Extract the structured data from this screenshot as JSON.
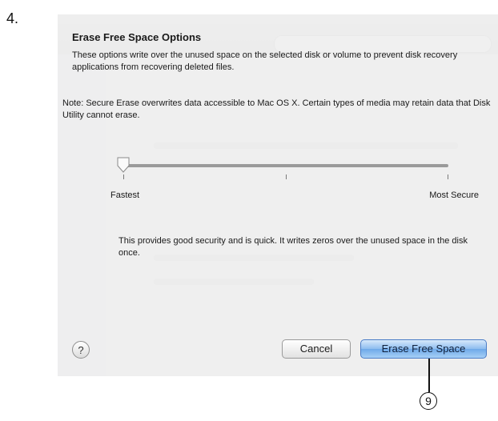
{
  "step": {
    "number": "4."
  },
  "sheet": {
    "title": "Erase Free Space Options",
    "description": "These options write over the unused space on the selected disk or volume to prevent disk recovery applications from recovering deleted files.",
    "note": "Note: Secure Erase overwrites data accessible to Mac OS X. Certain types of media may retain data that Disk Utility cannot erase.",
    "slider": {
      "min_label": "Fastest",
      "max_label": "Most Secure",
      "position_steps": 3,
      "selected_step": 1
    },
    "option_description": "This provides good security and is quick. It writes zeros over the unused space in the disk once.",
    "help_label": "?",
    "cancel_label": "Cancel",
    "erase_label": "Erase Free Space"
  },
  "callout": {
    "label": "9"
  },
  "colors": {
    "primary_button": "#8dbdef",
    "sheet_background": "#f0f0f0"
  }
}
